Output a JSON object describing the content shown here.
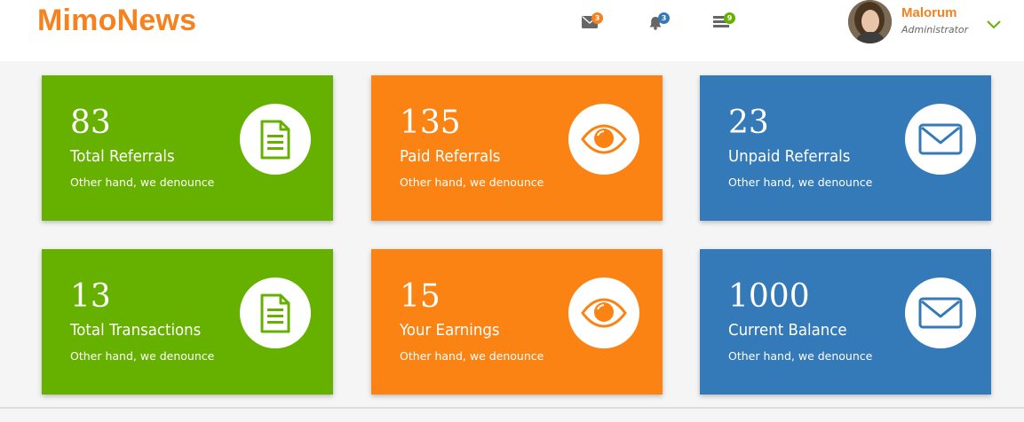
{
  "app": {
    "logo": "MimoNews"
  },
  "header": {
    "messages_badge": "3",
    "notifications_badge": "3",
    "tasks_badge": "9"
  },
  "user": {
    "name": "Malorum",
    "role": "Administrator"
  },
  "cards": [
    {
      "value": "83",
      "label": "Total Referrals",
      "desc": "Other hand, we denounce",
      "icon": "document-icon"
    },
    {
      "value": "135",
      "label": "Paid Referrals",
      "desc": "Other hand, we denounce",
      "icon": "eye-icon"
    },
    {
      "value": "23",
      "label": "Unpaid Referrals",
      "desc": "Other hand, we denounce",
      "icon": "envelope-icon"
    },
    {
      "value": "13",
      "label": "Total Transactions",
      "desc": "Other hand, we denounce",
      "icon": "document-icon"
    },
    {
      "value": "15",
      "label": "Your Earnings",
      "desc": "Other hand, we denounce",
      "icon": "eye-icon"
    },
    {
      "value": "1000",
      "label": "Current Balance",
      "desc": "Other hand, we denounce",
      "icon": "envelope-icon"
    }
  ],
  "colors": {
    "brand": "#f6821f",
    "green": "#66b000",
    "orange": "#fa8314",
    "blue": "#3479b8",
    "badge_messages": "#f6821f",
    "badge_notifications": "#3479b8",
    "badge_tasks": "#66b000"
  }
}
